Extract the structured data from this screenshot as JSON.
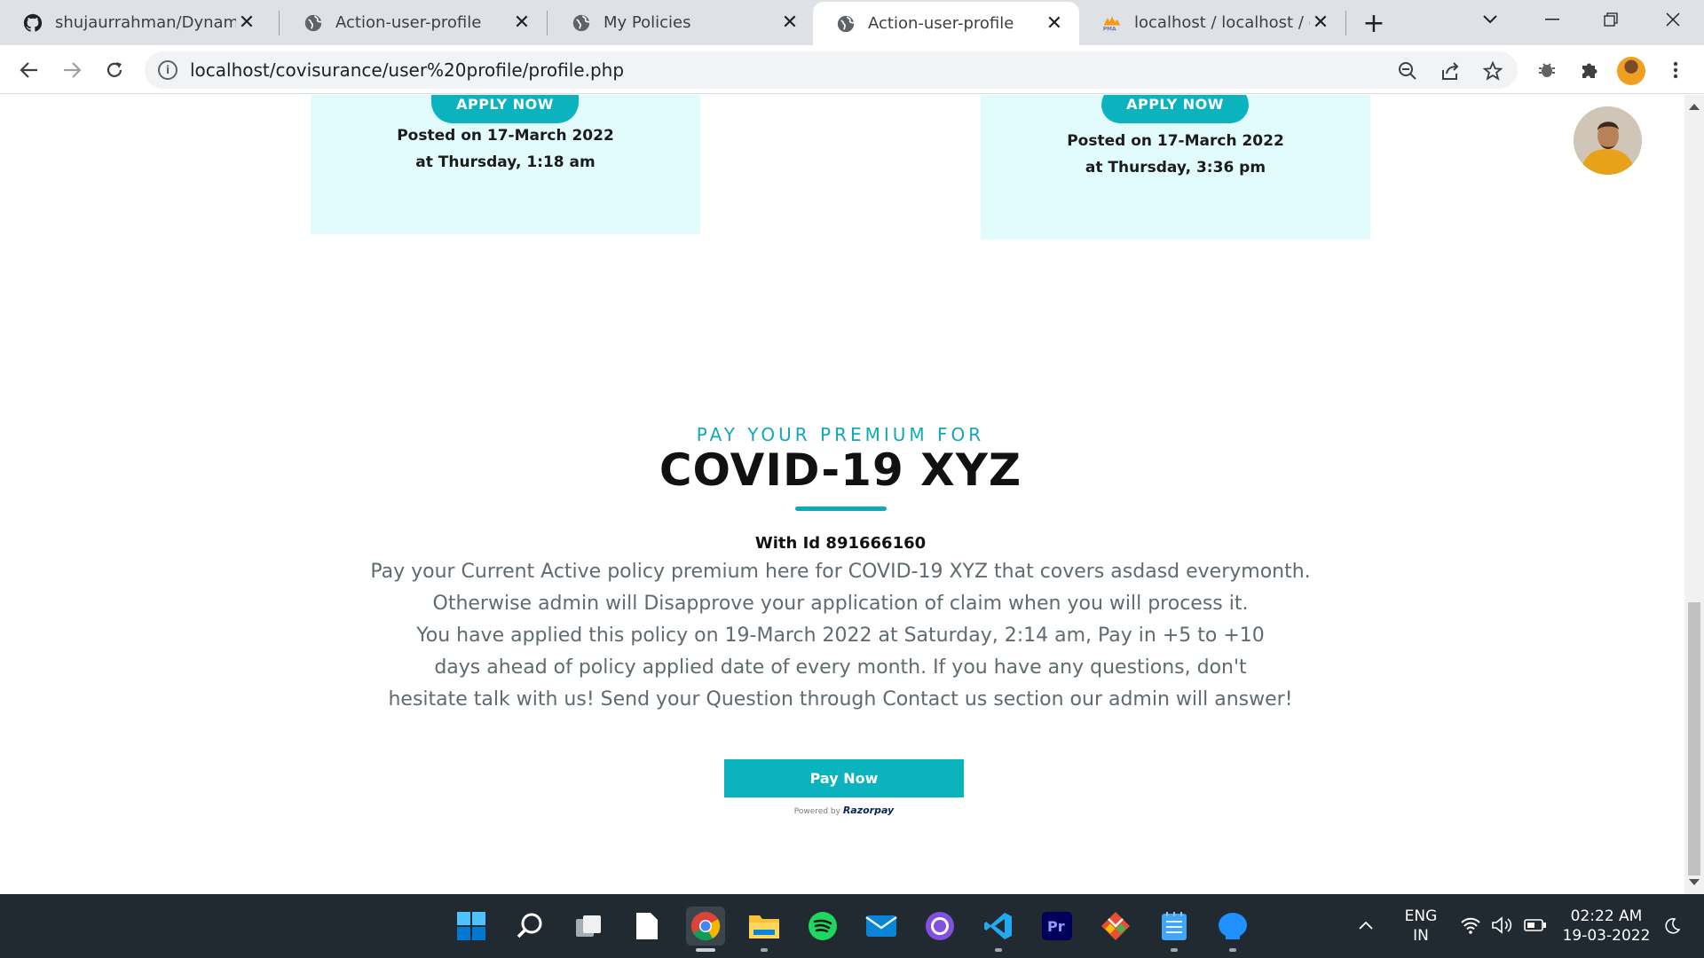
{
  "browser": {
    "tabs": [
      {
        "title": "shujaurrahman/Dynamic-I",
        "favicon": "github-icon",
        "active": false
      },
      {
        "title": "Action-user-profile",
        "favicon": "globe-icon",
        "active": false
      },
      {
        "title": "My Policies",
        "favicon": "globe-icon",
        "active": false
      },
      {
        "title": "Action-user-profile",
        "favicon": "globe-icon",
        "active": true
      },
      {
        "title": "localhost / localhost / cov",
        "favicon": "phpmyadmin-icon",
        "active": false
      }
    ],
    "url": "localhost/covisurance/user%20profile/profile.php",
    "close_glyph": "✕",
    "new_tab_glyph": "+"
  },
  "page": {
    "cards": [
      {
        "button_label": "APPLY NOW",
        "posted_line1": "Posted on 17-March 2022",
        "posted_line2": "at Thursday, 1:18 am"
      },
      {
        "button_label": "APPLY NOW",
        "posted_line1": "Posted on 17-March 2022",
        "posted_line2": "at Thursday, 3:36 pm"
      }
    ],
    "premium": {
      "kicker": "PAY YOUR PREMIUM FOR",
      "policy_name": "COVID-19 XYZ",
      "with_id": "With Id 891666160",
      "description_lines": [
        "Pay your Current Active policy premium here for COVID-19 XYZ that covers asdasd everymonth.",
        "Otherwise admin will Disapprove your application of claim when you will process it.",
        "You have applied this policy on 19-March 2022 at Saturday, 2:14 am, Pay in +5 to +10",
        "days ahead of policy applied date of every month. If you have any questions, don't",
        "hesitate talk with us! Send your Question through Contact us section our admin will answer!"
      ],
      "pay_button": "Pay Now",
      "powered_by": "Powered by",
      "razorpay": "Razorpay"
    },
    "accent_color": "#0bb3bf"
  },
  "taskbar": {
    "apps": [
      "windows-start-icon",
      "search-icon",
      "task-view-icon",
      "file-icon",
      "chrome-icon",
      "file-explorer-icon",
      "spotify-icon",
      "mail-icon",
      "github-desktop-icon",
      "vscode-icon",
      "premiere-pro-icon",
      "git-icon",
      "notepad-icon",
      "app-icon"
    ],
    "premiere_label": "Pr",
    "language": "ENG",
    "region": "IN",
    "time": "02:22 AM",
    "date": "19-03-2022"
  }
}
